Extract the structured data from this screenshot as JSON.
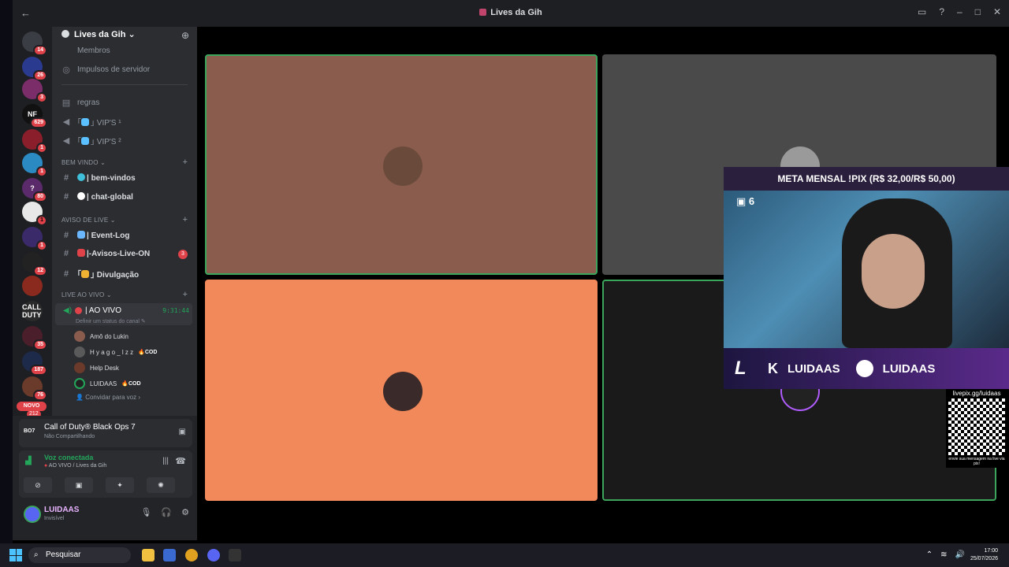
{
  "window": {
    "title": "Lives da Gih",
    "back_icon": "arrow-left-icon"
  },
  "servers": [
    {
      "label": "",
      "badge": "14",
      "color": "#3b3d44"
    },
    {
      "label": "",
      "badge": "26",
      "color": "#2a3b8f"
    },
    {
      "label": "",
      "badge": "3",
      "color": "#7b2d6a"
    },
    {
      "label": "NF",
      "badge": "629",
      "color": "#111111"
    },
    {
      "label": "",
      "badge": "1",
      "color": "#8a1e2b"
    },
    {
      "label": "",
      "badge": "1",
      "color": "#2b8ac2"
    },
    {
      "label": "?",
      "badge": "80",
      "color": "#5a2a6a"
    },
    {
      "label": "",
      "badge": "1",
      "color": "#e8e8e8"
    },
    {
      "label": "",
      "badge": "1",
      "color": "#3a2a6a"
    },
    {
      "label": "",
      "badge": "12",
      "color": "#222222"
    },
    {
      "label": "",
      "badge": "",
      "color": "#8a2a1e"
    },
    {
      "label": "CALL DUTY",
      "badge": "",
      "color": "#2a2a2a"
    },
    {
      "label": "",
      "badge": "35",
      "color": "#4a1e2a"
    },
    {
      "label": "",
      "badge": "187",
      "color": "#1e2a4a"
    },
    {
      "label": "",
      "badge": "76",
      "color": "#6a3a2a"
    }
  ],
  "novo": {
    "label": "NOVO",
    "count": "212"
  },
  "guild": {
    "name": "Lives da Gih"
  },
  "channels": {
    "membros": "Membros",
    "impulsos": "Impulsos de servidor",
    "regras": "regras",
    "vips1": "VIP'S ¹",
    "vips2": "VIP'S ²",
    "cat_bem_vindo": "BEM VINDO",
    "bem_vindos": "| bem-vindos",
    "chat_global": "| chat-global",
    "cat_aviso": "AVISO DE LIVE",
    "event_log": "| Event-Log",
    "avisos": "|-Avisos-Live-ON",
    "avisos_unread": "3",
    "divulgacao": "Divulgação",
    "cat_live": "LIVE AO VIVO",
    "ao_vivo": "| AO VIVO",
    "timer": "9:31:44",
    "status_hint": "Definir um status do canal",
    "users": [
      {
        "name": "Amô do Lukin",
        "tag": ""
      },
      {
        "name": "H y a g o _ l z z",
        "tag": "COD"
      },
      {
        "name": "Help Desk",
        "tag": ""
      },
      {
        "name": "LUIDAAS",
        "tag": "COD"
      }
    ],
    "invite": "Convidar para voz"
  },
  "activity": {
    "title": "Call of Duty® Black Ops 7",
    "subtitle": "Não Compartilhando",
    "logo": "BO7"
  },
  "voice": {
    "title": "Voz conectada",
    "subtitle": "AO VIVO / Lives da Gih"
  },
  "me": {
    "name": "LUIDAAS",
    "status": "Invisível"
  },
  "overlay": {
    "meta": "META MENSAL !PIX (R$ 32,00/R$ 50,00)",
    "viewers": "6",
    "brand_left": "LUIDAAS",
    "brand_right": "LUIDAAS",
    "qr_url": "livepix.gg/luidaas",
    "qr_footer": "envie sua mensagem na live via pix!"
  },
  "tiles": [
    {
      "color": "#8a5c4e",
      "border": "#3ba55c"
    },
    {
      "color": "#4a4a4a",
      "border": "transparent"
    },
    {
      "color": "#f2895a",
      "border": "transparent"
    },
    {
      "color": "#1a1a1a",
      "border": "#3ba55c"
    }
  ],
  "taskbar": {
    "search": "Pesquisar",
    "time": "17:00",
    "date": "25/07/2026"
  }
}
